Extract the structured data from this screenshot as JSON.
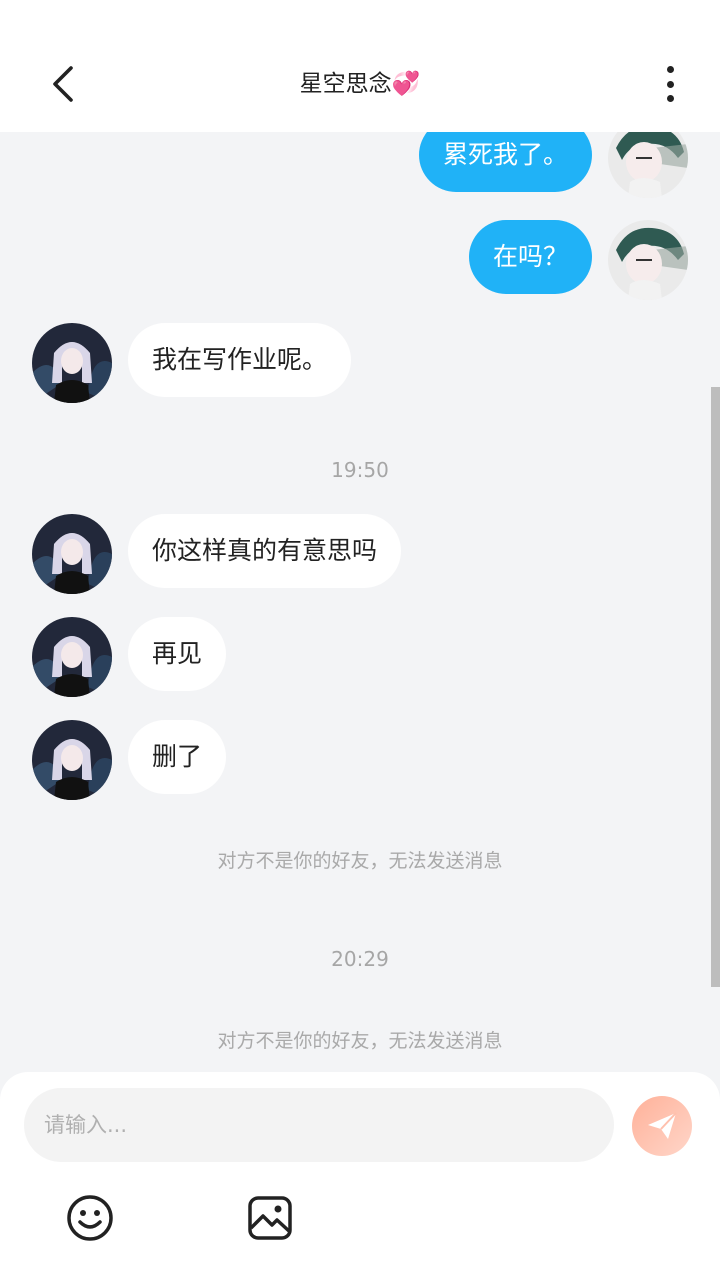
{
  "header": {
    "title": "星空思念💞"
  },
  "messages": [
    {
      "side": "out",
      "text": "累死我了。"
    },
    {
      "side": "out",
      "text": "在吗？"
    },
    {
      "side": "in",
      "text": "我在写作业呢。"
    },
    {
      "side": "in",
      "text": "你这样真的有意思吗"
    },
    {
      "side": "in",
      "text": "再见"
    },
    {
      "side": "in",
      "text": "删了"
    }
  ],
  "timestamps": [
    "19:50",
    "20:29"
  ],
  "notices": [
    "对方不是你的好友，无法发送消息",
    "对方不是你的好友，无法发送消息"
  ],
  "composer": {
    "placeholder": "请输入..."
  },
  "icons": {
    "back": "chevron-left-icon",
    "more": "more-vertical-icon",
    "send": "paper-plane-icon",
    "emoji": "smiley-icon",
    "image": "image-icon"
  },
  "colors": {
    "outgoing_bubble": "#20b2f7",
    "incoming_bubble": "#ffffff",
    "background": "#f3f4f6",
    "send_button": "#ffc5b3"
  }
}
